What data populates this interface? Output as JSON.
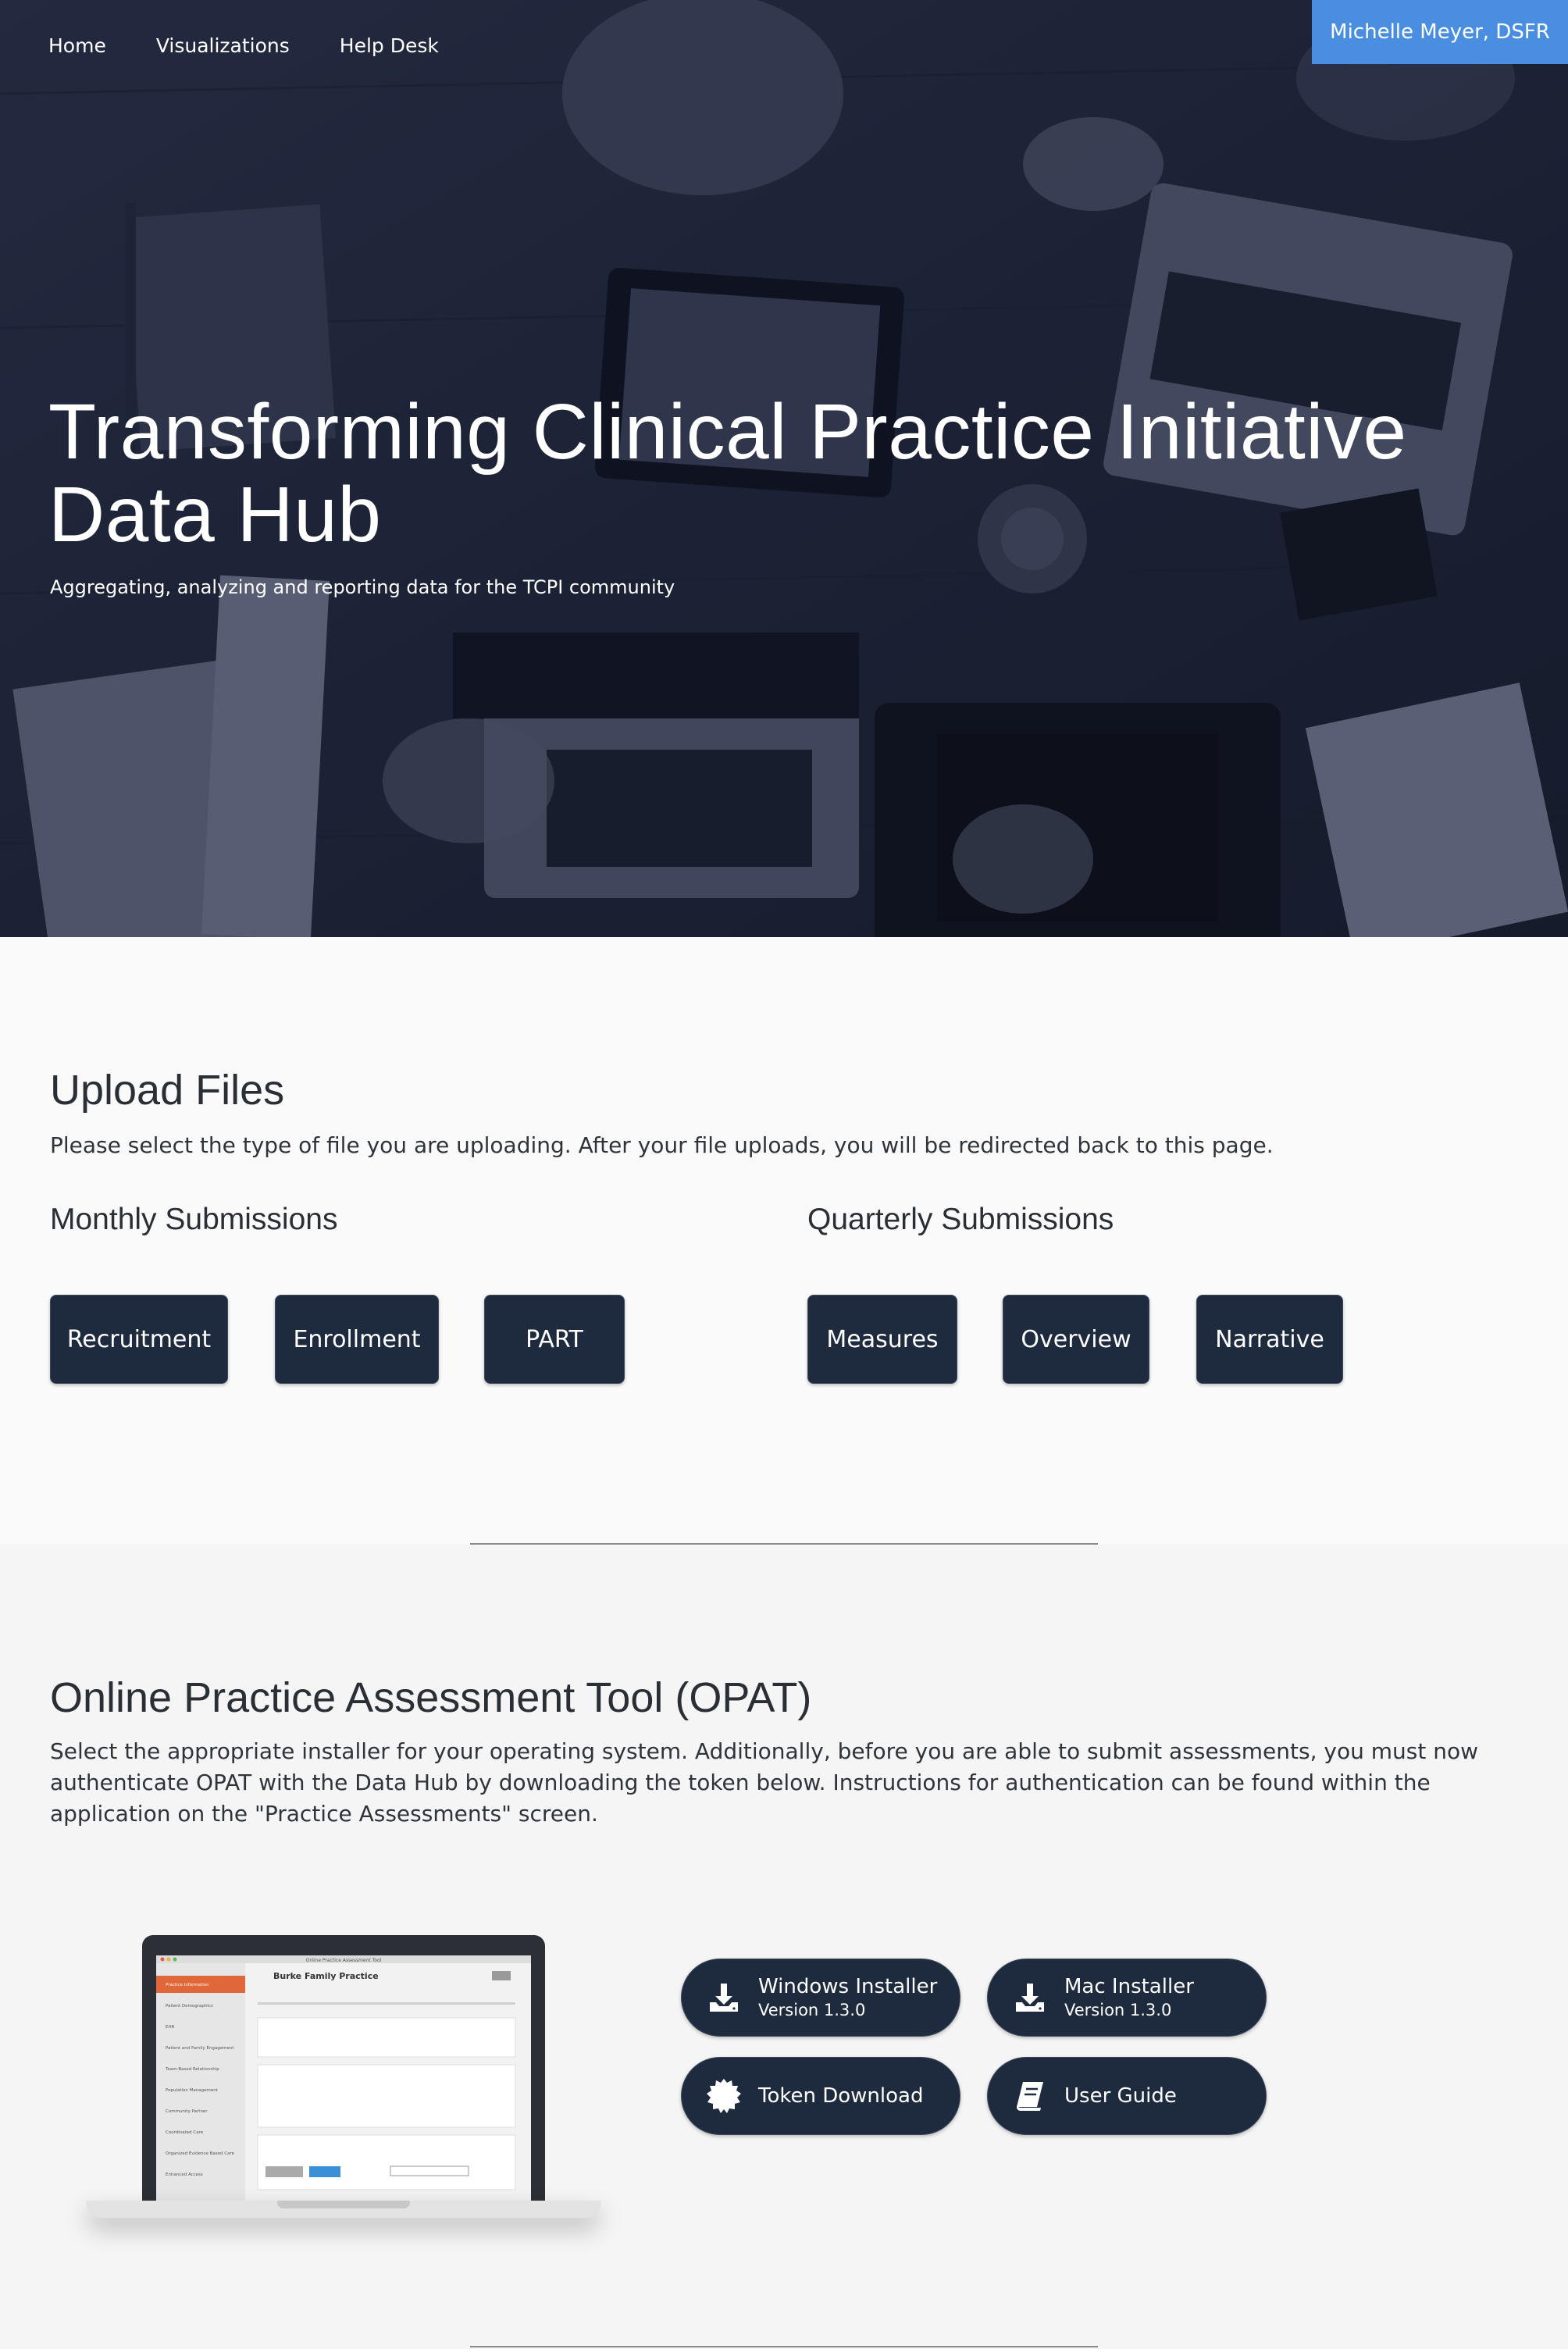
{
  "nav": {
    "items": [
      "Home",
      "Visualizations",
      "Help Desk"
    ],
    "user": "Michelle Meyer, DSFR"
  },
  "hero": {
    "title_line1": "Transforming Clinical Practice Initiative",
    "title_line2": "Data Hub",
    "subtitle": "Aggregating, analyzing and reporting data for the TCPI community"
  },
  "upload": {
    "title": "Upload Files",
    "description": "Please select the type of file you are uploading. After your file uploads, you will be redirected back to this page.",
    "monthly": {
      "title": "Monthly Submissions",
      "buttons": [
        "Recruitment",
        "Enrollment",
        "PART"
      ]
    },
    "quarterly": {
      "title": "Quarterly Submissions",
      "buttons": [
        "Measures",
        "Overview",
        "Narrative"
      ]
    }
  },
  "opat": {
    "title": "Online Practice Assessment Tool (OPAT)",
    "description": "Select the appropriate installer for your operating system. Additionally, before you are able to submit assessments, you must now authenticate OPAT with the Data Hub by downloading the token below. Instructions for authentication can be found within the application on the \"Practice Assessments\" screen.",
    "buttons": {
      "windows": {
        "label": "Windows Installer",
        "version": "Version 1.3.0",
        "icon": "download-icon"
      },
      "mac": {
        "label": "Mac Installer",
        "version": "Version 1.3.0",
        "icon": "download-icon"
      },
      "token": {
        "label": "Token Download",
        "icon": "badge-icon"
      },
      "guide": {
        "label": "User Guide",
        "icon": "book-icon"
      }
    },
    "laptop_screen": {
      "window_title": "Online Practice Assessment Tool",
      "practice_name": "Burke Family Practice",
      "sidebar_items": [
        "Practice Information",
        "Patient Demographics",
        "EHR",
        "Patient and Family Engagement",
        "Team-Based Relationship",
        "Population Management",
        "Community Partner",
        "Coordinated Care",
        "Organized Evidence Based Care",
        "Enhanced Access"
      ]
    }
  },
  "colors": {
    "accent_blue": "#4a8ee2",
    "button_dark": "#1e2a3e",
    "hero_overlay": "#1c2234"
  }
}
